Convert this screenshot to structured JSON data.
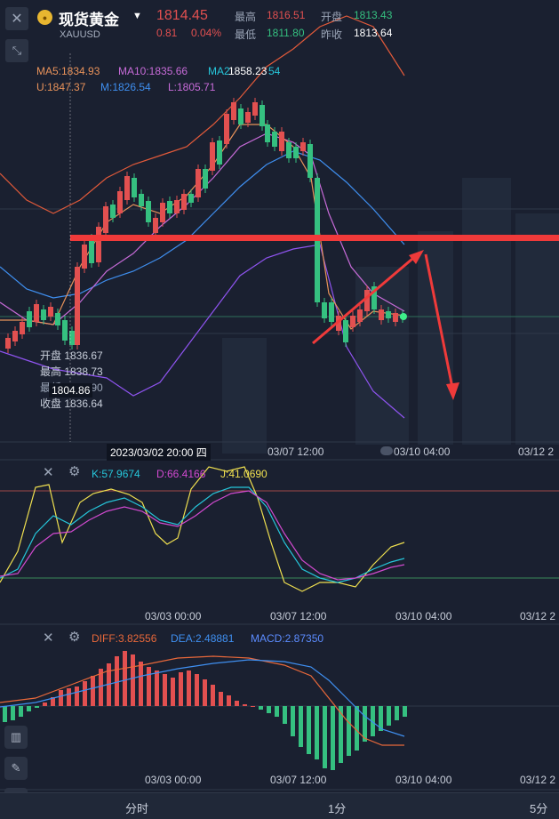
{
  "header": {
    "name": "现货黄金",
    "symbol": "XAUUSD",
    "price": "1814.45",
    "change": "0.81",
    "change_pct": "0.04%",
    "high_label": "最高",
    "high_value": "1816.51",
    "low_label": "最低",
    "low_value": "1811.80",
    "open_label": "开盘",
    "open_value": "1813.43",
    "prev_label": "昨收",
    "prev_value": "1813.64"
  },
  "ma_legend": {
    "ma5": "MA5:1834.93",
    "ma10": "MA10:1835.66",
    "ma20_overlap": "MA2",
    "ma20_value": "1858.23",
    "ma20_tail": "54",
    "boll_u": "U:1847.37",
    "boll_m": "M:1826.54",
    "boll_l": "L:1805.71"
  },
  "ohlc_tooltip": {
    "open": "开盘 1836.67",
    "high": "最高 1838.73",
    "low_overlap": "最低 1829.90",
    "cursor_price": "1804.86",
    "close": "收盘 1836.64"
  },
  "cursor_date": "2023/03/02 20:00 四",
  "main_dates": [
    "03/07 12:00",
    "03/10 04:00",
    "03/12 2"
  ],
  "kdj": {
    "k": "K:57.9674",
    "d": "D:66.4166",
    "j": "J:41.0690",
    "dates": [
      "03/03 00:00",
      "03/07 12:00",
      "03/10 04:00",
      "03/12 2"
    ]
  },
  "macd": {
    "diff": "DIFF:3.82556",
    "dea": "DEA:2.48881",
    "macd": "MACD:2.87350",
    "dates": [
      "03/03 00:00",
      "03/07 12:00",
      "03/10 04:00",
      "03/12 2"
    ]
  },
  "tabs": [
    "分时",
    "1分",
    "5分"
  ],
  "colors": {
    "up": "#e25050",
    "down": "#35c080",
    "ma5": "#e8925a",
    "ma10": "#c76bd8",
    "ma20": "#3f8ff0",
    "boll_u": "#e25a3a",
    "boll_l": "#8f54f0",
    "annotation": "#f03a3a",
    "kdj_k": "#26c6da",
    "kdj_d": "#d24ad0",
    "kdj_j": "#f0e050"
  },
  "icons": [
    "close-icon",
    "shrink-icon",
    "coin-icon",
    "caret-down-icon",
    "indicator-close-icon",
    "indicator-settings-icon",
    "candle-icon",
    "pencil-icon",
    "line-chart-icon"
  ]
}
